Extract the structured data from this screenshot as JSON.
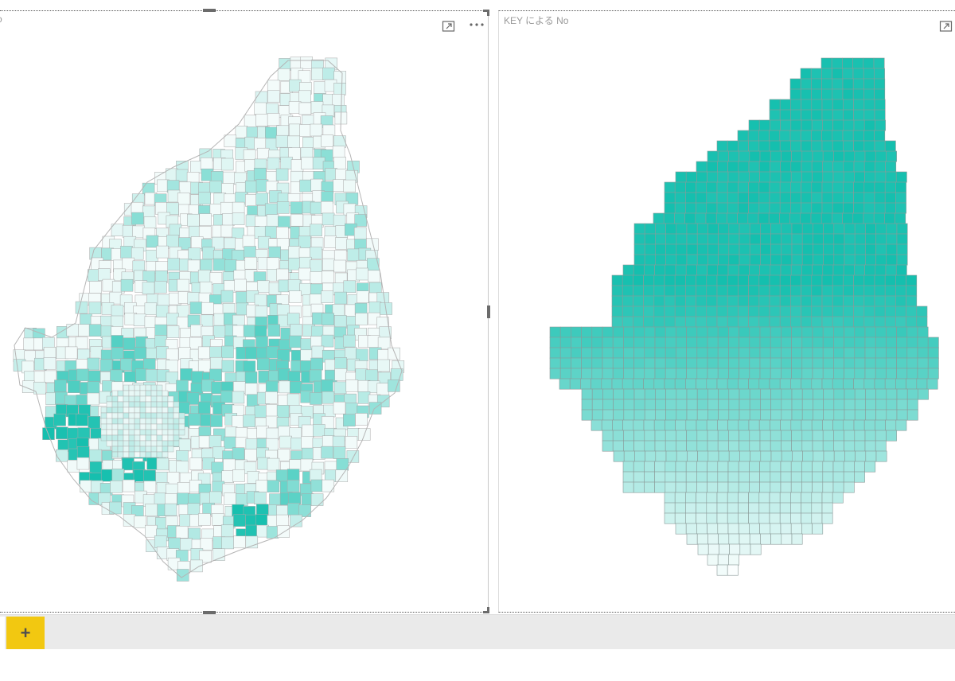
{
  "left_visual": {
    "title": "o",
    "icons": {
      "focus": "focus-mode-icon",
      "more": "more-options-icon"
    },
    "map": {
      "type": "filled-map",
      "color_low": "#f3fbfa",
      "color_high": "#15bfae",
      "border_color": "#a8a8a8"
    }
  },
  "right_visual": {
    "title": "KEY による No",
    "icons": {
      "focus": "focus-mode-icon"
    },
    "map": {
      "type": "tile-grid-map",
      "color_low": "#ffffff",
      "color_high": "#14bfae",
      "border_color": "#8a9a98"
    }
  },
  "page_tabs": {
    "add_label": "+",
    "add_icon": "plus-icon",
    "accent": "#f2c811"
  }
}
